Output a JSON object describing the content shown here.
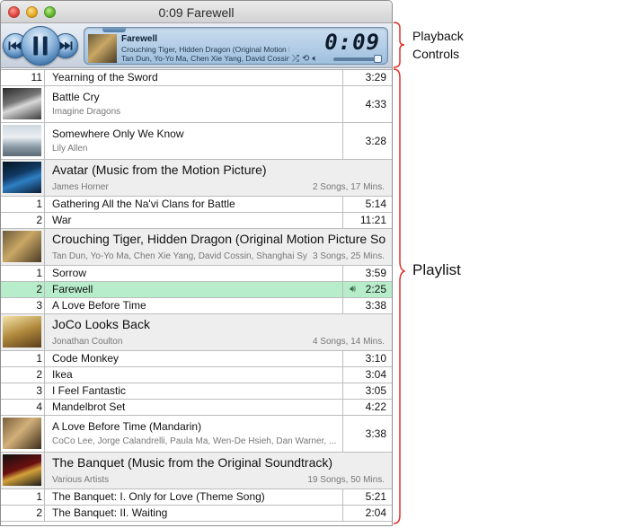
{
  "window": {
    "title": "0:09 Farewell"
  },
  "now_playing": {
    "title": "Farewell",
    "album": "Crouching Tiger, Hidden Dragon (Original Motion Pic",
    "artists": "Tan Dun, Yo-Yo Ma, Chen Xie Yang, David Cossin, S",
    "time": "0:09",
    "volume_level": 0.85
  },
  "annotations": {
    "playback_line1": "Playback",
    "playback_line2": "Controls",
    "playlist": "Playlist"
  },
  "playlist": {
    "rows": [
      {
        "kind": "track",
        "num": "11",
        "name": "Yearning of the Sword",
        "time": "3:29"
      },
      {
        "kind": "single",
        "art": "battle-cry-art",
        "name": "Battle Cry",
        "artist": "Imagine Dragons",
        "time": "4:33"
      },
      {
        "kind": "single",
        "art": "lily-allen-art",
        "name": "Somewhere Only We Know",
        "artist": "Lily Allen",
        "time": "3:28"
      },
      {
        "kind": "album",
        "art": "avatar-art",
        "name": "Avatar (Music from the Motion Picture)",
        "artist": "James Horner",
        "info": "2 Songs, 17 Mins."
      },
      {
        "kind": "track",
        "num": "1",
        "name": "Gathering All the Na'vi Clans for Battle",
        "time": "5:14"
      },
      {
        "kind": "track",
        "num": "2",
        "name": "War",
        "time": "11:21"
      },
      {
        "kind": "album",
        "art": "crouching-tiger-art",
        "name": "Crouching Tiger, Hidden Dragon (Original Motion Picture So",
        "artist": "Tan Dun, Yo-Yo Ma, Chen Xie Yang, David Cossin, Shanghai Sy",
        "info": "3 Songs, 25 Mins."
      },
      {
        "kind": "track",
        "num": "1",
        "name": "Sorrow",
        "time": "3:59"
      },
      {
        "kind": "playing",
        "num": "2",
        "name": "Farewell",
        "time": "2:25"
      },
      {
        "kind": "track",
        "num": "3",
        "name": "A Love Before Time",
        "time": "3:38"
      },
      {
        "kind": "album",
        "art": "joco-art",
        "name": "JoCo Looks Back",
        "artist": "Jonathan Coulton",
        "info": "4 Songs, 14 Mins."
      },
      {
        "kind": "track",
        "num": "1",
        "name": "Code Monkey",
        "time": "3:10"
      },
      {
        "kind": "track",
        "num": "2",
        "name": "Ikea",
        "time": "3:04"
      },
      {
        "kind": "track",
        "num": "3",
        "name": "I Feel Fantastic",
        "time": "3:05"
      },
      {
        "kind": "track",
        "num": "4",
        "name": "Mandelbrot Set",
        "time": "4:22"
      },
      {
        "kind": "single",
        "art": "mandarin-art",
        "name": "A Love Before Time (Mandarin)",
        "artist": "CoCo Lee, Jorge Calandrelli, Paula Ma, Wen-De Hsieh, Dan Warner, ...",
        "time": "3:38"
      },
      {
        "kind": "album",
        "art": "banquet-art",
        "name": "The Banquet (Music from the Original Soundtrack)",
        "artist": "Various Artists",
        "info": "19 Songs, 50 Mins."
      },
      {
        "kind": "track",
        "num": "1",
        "name": "The Banquet: I. Only for Love (Theme Song)",
        "time": "5:21"
      },
      {
        "kind": "track",
        "num": "2",
        "name": "The Banquet: II. Waiting",
        "time": "2:04"
      }
    ]
  },
  "colors": {
    "playing_row": "#b8edcc",
    "album_row": "#eeeeee",
    "brace": "#e0302a"
  }
}
